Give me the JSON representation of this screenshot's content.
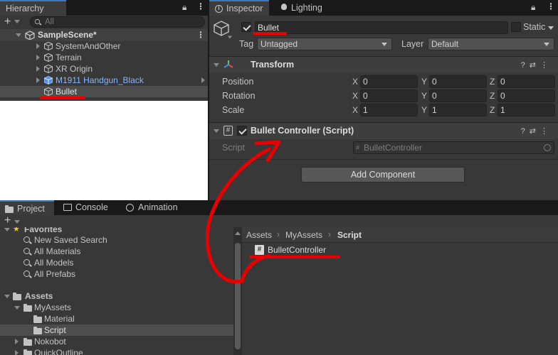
{
  "hierarchy": {
    "tab_label": "Hierarchy",
    "search_placeholder": "All",
    "scene_name": "SampleScene*",
    "items": [
      {
        "label": "SystemAndOther"
      },
      {
        "label": "Terrain"
      },
      {
        "label": "XR Origin"
      },
      {
        "label": "M1911 Handgun_Black"
      },
      {
        "label": "Bullet"
      }
    ]
  },
  "inspector": {
    "tab_label": "Inspector",
    "lighting_tab_label": "Lighting",
    "object_name": "Bullet",
    "static_label": "Static",
    "tag_label": "Tag",
    "tag_value": "Untagged",
    "layer_label": "Layer",
    "layer_value": "Default",
    "transform": {
      "title": "Transform",
      "position_label": "Position",
      "rotation_label": "Rotation",
      "scale_label": "Scale",
      "x": "X",
      "y": "Y",
      "z": "Z",
      "position": [
        "0",
        "0",
        "0"
      ],
      "rotation": [
        "0",
        "0",
        "0"
      ],
      "scale": [
        "1",
        "1",
        "1"
      ]
    },
    "script_component": {
      "title": "Bullet Controller (Script)",
      "script_label": "Script",
      "script_value": "BulletController"
    },
    "add_component_label": "Add Component"
  },
  "project": {
    "tabs": [
      "Project",
      "Console",
      "Animation"
    ],
    "favorites_label": "Favorites",
    "favorites": [
      "New Saved Search",
      "All Materials",
      "All Models",
      "All Prefabs"
    ],
    "assets_label": "Assets",
    "tree": {
      "myassets": "MyAssets",
      "material": "Material",
      "script": "Script",
      "nokobot": "Nokobot",
      "quickoutline": "QuickOutline"
    },
    "breadcrumb": [
      "Assets",
      "MyAssets",
      "Script"
    ],
    "file_label": "BulletController"
  },
  "colors": {
    "accent": "#3a79bb",
    "annotation_red": "#e80000",
    "prefab_blue": "#8ab4f8"
  }
}
